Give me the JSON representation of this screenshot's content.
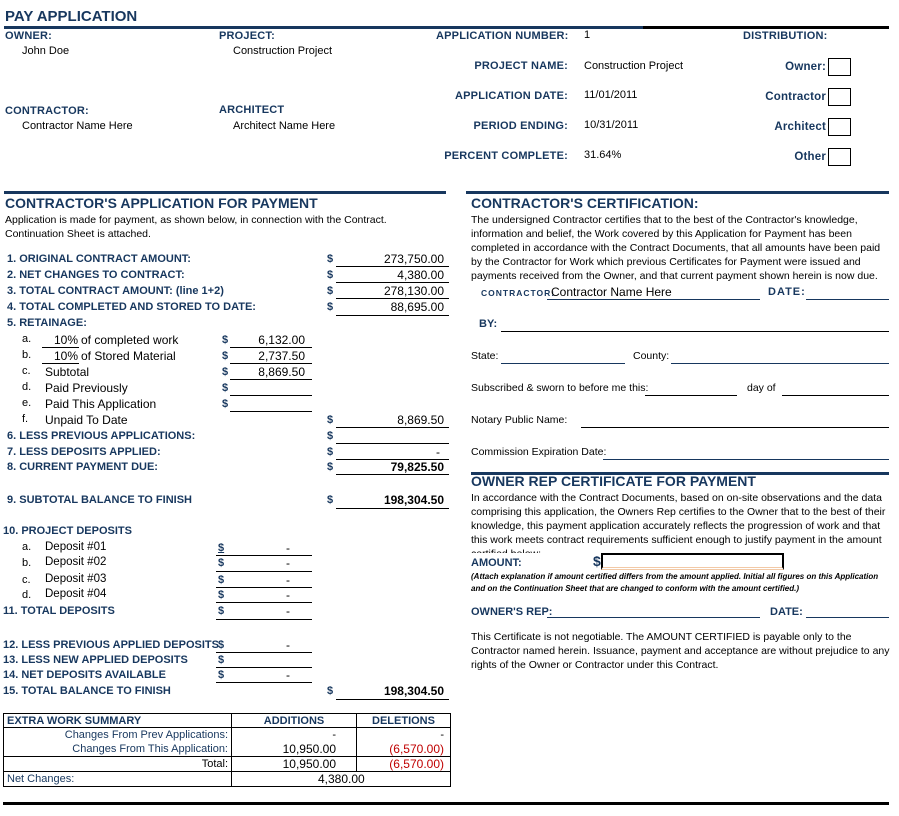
{
  "title": "PAY APPLICATION",
  "header": {
    "owner_label": "OWNER:",
    "owner_value": "John Doe",
    "project_label": "PROJECT:",
    "project_value": "Construction Project",
    "contractor_label": "CONTRACTOR:",
    "contractor_value": "Contractor Name Here",
    "architect_label": "ARCHITECT",
    "architect_value": "Architect Name Here",
    "application_number_label": "APPLICATION NUMBER:",
    "application_number_value": "1",
    "project_name_label": "PROJECT NAME:",
    "project_name_value": "Construction Project",
    "application_date_label": "APPLICATION DATE:",
    "application_date_value": "11/01/2011",
    "period_ending_label": "PERIOD ENDING:",
    "period_ending_value": "10/31/2011",
    "percent_complete_label": "PERCENT COMPLETE:",
    "percent_complete_value": "31.64%",
    "distribution_label": "DISTRIBUTION:",
    "distribution": [
      {
        "label": "Owner:",
        "checked": false
      },
      {
        "label": "Contractor",
        "checked": false
      },
      {
        "label": "Architect",
        "checked": false
      },
      {
        "label": "Other",
        "checked": false
      }
    ]
  },
  "application": {
    "heading": "CONTRACTOR'S APPLICATION FOR PAYMENT",
    "intro": "Application is made for payment, as shown below, in connection with the Contract. Continuation Sheet is attached.",
    "currency": "$",
    "lines": {
      "l1": {
        "label": "1. ORIGINAL CONTRACT AMOUNT:",
        "value": "273,750.00"
      },
      "l2": {
        "label": "2. NET CHANGES TO CONTRACT:",
        "value": "4,380.00"
      },
      "l3": {
        "label": "3. TOTAL CONTRACT AMOUNT: (line 1+2)",
        "value": "278,130.00"
      },
      "l4": {
        "label": "4. TOTAL COMPLETED AND STORED TO DATE:",
        "value": "88,695.00"
      },
      "l5": {
        "label": "5. RETAINAGE:"
      },
      "l5a": {
        "letter": "a.",
        "pct": "10%",
        "label": "of completed work",
        "value": "6,132.00"
      },
      "l5b": {
        "letter": "b.",
        "pct": "10%",
        "label": "of Stored Material",
        "value": "2,737.50"
      },
      "l5c": {
        "letter": "c.",
        "label": "Subtotal",
        "value": "8,869.50"
      },
      "l5d": {
        "letter": "d.",
        "label": "Paid Previously",
        "value": ""
      },
      "l5e": {
        "letter": "e.",
        "label": "Paid This Application",
        "value": ""
      },
      "l5f": {
        "letter": "f.",
        "label": "Unpaid To Date",
        "value": "8,869.50"
      },
      "l6": {
        "label": "6. LESS PREVIOUS APPLICATIONS:",
        "value": ""
      },
      "l7": {
        "label": "7. LESS DEPOSITS APPLIED:",
        "value": "-"
      },
      "l8": {
        "label": "8. CURRENT PAYMENT DUE:",
        "value": "79,825.50"
      },
      "l9": {
        "label": "9. SUBTOTAL BALANCE TO FINISH",
        "value": "198,304.50"
      },
      "l10": {
        "label": "10. PROJECT DEPOSITS"
      },
      "l10a": {
        "letter": "a.",
        "label": "Deposit #01",
        "value": "-"
      },
      "l10b": {
        "letter": "b.",
        "label": "Deposit #02",
        "value": "-"
      },
      "l10c": {
        "letter": "c.",
        "label": "Deposit #03",
        "value": "-"
      },
      "l10d": {
        "letter": "d.",
        "label": "Deposit #04",
        "value": "-"
      },
      "l11": {
        "label": "11. TOTAL DEPOSITS",
        "value": "-"
      },
      "l12": {
        "label": "12. LESS PREVIOUS APPLIED DEPOSITS",
        "value": "-"
      },
      "l13": {
        "label": "13. LESS NEW APPLIED DEPOSITS",
        "value": ""
      },
      "l14": {
        "label": "14. NET DEPOSITS AVAILABLE",
        "value": "-"
      },
      "l15": {
        "label": "15. TOTAL BALANCE TO FINISH",
        "value": "198,304.50"
      }
    }
  },
  "extra_work": {
    "title": "EXTRA WORK SUMMARY",
    "col_additions": "ADDITIONS",
    "col_deletions": "DELETIONS",
    "rows": [
      {
        "label": "Changes From Prev Applications:",
        "additions": "-",
        "deletions": "-"
      },
      {
        "label": "Changes From This Application:",
        "additions": "10,950.00",
        "deletions": "(6,570.00)"
      },
      {
        "label": "Total:",
        "additions": "10,950.00",
        "deletions": "(6,570.00)"
      }
    ],
    "net_label": "Net Changes:",
    "net_value": "4,380.00"
  },
  "certification": {
    "heading": "CONTRACTOR'S CERTIFICATION:",
    "text": "The undersigned Contractor certifies that to the best of the Contractor's knowledge, information and belief, the Work covered by this Application for Payment has been completed in accordance with the Contract Documents, that all amounts have been paid by the Contractor for Work which previous Certificates for Payment were issued and payments received from the Owner, and that current payment shown herein is now due.",
    "contractor_label": "CONTRACTOR:",
    "contractor_value": "Contractor Name Here",
    "date_label": "DATE:",
    "by_label": "BY:",
    "state_label": "State:",
    "county_label": "County:",
    "sworn_label": "Subscribed & sworn to before me this:",
    "day_of_label": "day of",
    "notary_label": "Notary Public Name:",
    "commission_label": "Commission Expiration Date:"
  },
  "owner_rep": {
    "heading": "OWNER REP CERTIFICATE FOR PAYMENT",
    "text": "In accordance with the Contract Documents, based on on-site observations and the data comprising this application, the Owners Rep certifies to the Owner that to the best of their knowledge, this payment application accurately reflects the progression of work and that this work meets contract requirements sufficient enough to justify payment in the amount certified below:",
    "amount_label": "AMOUNT:",
    "amount_currency": "$",
    "amount_value": "",
    "note": "(Attach explanation if amount certified differs from the amount applied. Initial all figures on this Application and on the Continuation Sheet that are changed to conform with the amount certified.)",
    "rep_label": "OWNER'S REP:",
    "date_label": "DATE:",
    "disclaimer": "This Certificate is not negotiable. The AMOUNT CERTIFIED is payable only to the Contractor named herein. Issuance, payment and acceptance are without prejudice to any rights of the Owner or Contractor under this Contract."
  }
}
